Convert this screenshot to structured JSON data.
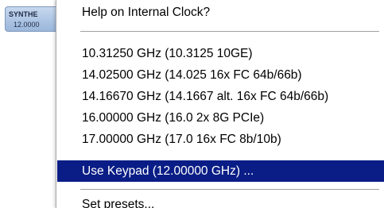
{
  "synth_button": {
    "title": "SYNTHE",
    "value": "12.0000"
  },
  "menu": {
    "help_label": "Help on Internal Clock?",
    "items": [
      {
        "label": "10.31250 GHz (10.3125 10GE)"
      },
      {
        "label": "14.02500 GHz (14.025 16x FC 64b/66b)"
      },
      {
        "label": "14.16670 GHz (14.1667 alt. 16x FC 64b/66b)"
      },
      {
        "label": "16.00000 GHz (16.0 2x 8G PCIe)"
      },
      {
        "label": "17.00000 GHz (17.0 16x FC 8b/10b)"
      },
      {
        "label": "Use Keypad (12.00000 GHz) ..."
      }
    ],
    "set_presets_label": "Set presets...",
    "highlight_color": "#0a1d86"
  }
}
